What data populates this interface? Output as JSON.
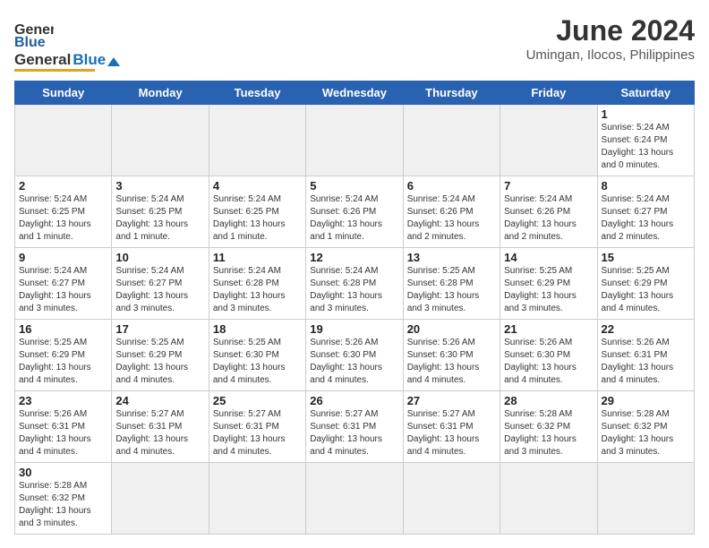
{
  "header": {
    "logo_general": "General",
    "logo_blue": "Blue",
    "title": "June 2024",
    "subtitle": "Umingan, Ilocos, Philippines"
  },
  "days_of_week": [
    "Sunday",
    "Monday",
    "Tuesday",
    "Wednesday",
    "Thursday",
    "Friday",
    "Saturday"
  ],
  "weeks": [
    [
      {
        "day": "",
        "info": ""
      },
      {
        "day": "",
        "info": ""
      },
      {
        "day": "",
        "info": ""
      },
      {
        "day": "",
        "info": ""
      },
      {
        "day": "",
        "info": ""
      },
      {
        "day": "",
        "info": ""
      },
      {
        "day": "1",
        "info": "Sunrise: 5:24 AM\nSunset: 6:24 PM\nDaylight: 13 hours and 0 minutes."
      }
    ],
    [
      {
        "day": "2",
        "info": "Sunrise: 5:24 AM\nSunset: 6:25 PM\nDaylight: 13 hours and 1 minute."
      },
      {
        "day": "3",
        "info": "Sunrise: 5:24 AM\nSunset: 6:25 PM\nDaylight: 13 hours and 1 minute."
      },
      {
        "day": "4",
        "info": "Sunrise: 5:24 AM\nSunset: 6:25 PM\nDaylight: 13 hours and 1 minute."
      },
      {
        "day": "5",
        "info": "Sunrise: 5:24 AM\nSunset: 6:26 PM\nDaylight: 13 hours and 1 minute."
      },
      {
        "day": "6",
        "info": "Sunrise: 5:24 AM\nSunset: 6:26 PM\nDaylight: 13 hours and 2 minutes."
      },
      {
        "day": "7",
        "info": "Sunrise: 5:24 AM\nSunset: 6:26 PM\nDaylight: 13 hours and 2 minutes."
      },
      {
        "day": "8",
        "info": "Sunrise: 5:24 AM\nSunset: 6:27 PM\nDaylight: 13 hours and 2 minutes."
      }
    ],
    [
      {
        "day": "9",
        "info": "Sunrise: 5:24 AM\nSunset: 6:27 PM\nDaylight: 13 hours and 3 minutes."
      },
      {
        "day": "10",
        "info": "Sunrise: 5:24 AM\nSunset: 6:27 PM\nDaylight: 13 hours and 3 minutes."
      },
      {
        "day": "11",
        "info": "Sunrise: 5:24 AM\nSunset: 6:28 PM\nDaylight: 13 hours and 3 minutes."
      },
      {
        "day": "12",
        "info": "Sunrise: 5:24 AM\nSunset: 6:28 PM\nDaylight: 13 hours and 3 minutes."
      },
      {
        "day": "13",
        "info": "Sunrise: 5:25 AM\nSunset: 6:28 PM\nDaylight: 13 hours and 3 minutes."
      },
      {
        "day": "14",
        "info": "Sunrise: 5:25 AM\nSunset: 6:29 PM\nDaylight: 13 hours and 3 minutes."
      },
      {
        "day": "15",
        "info": "Sunrise: 5:25 AM\nSunset: 6:29 PM\nDaylight: 13 hours and 4 minutes."
      }
    ],
    [
      {
        "day": "16",
        "info": "Sunrise: 5:25 AM\nSunset: 6:29 PM\nDaylight: 13 hours and 4 minutes."
      },
      {
        "day": "17",
        "info": "Sunrise: 5:25 AM\nSunset: 6:29 PM\nDaylight: 13 hours and 4 minutes."
      },
      {
        "day": "18",
        "info": "Sunrise: 5:25 AM\nSunset: 6:30 PM\nDaylight: 13 hours and 4 minutes."
      },
      {
        "day": "19",
        "info": "Sunrise: 5:26 AM\nSunset: 6:30 PM\nDaylight: 13 hours and 4 minutes."
      },
      {
        "day": "20",
        "info": "Sunrise: 5:26 AM\nSunset: 6:30 PM\nDaylight: 13 hours and 4 minutes."
      },
      {
        "day": "21",
        "info": "Sunrise: 5:26 AM\nSunset: 6:30 PM\nDaylight: 13 hours and 4 minutes."
      },
      {
        "day": "22",
        "info": "Sunrise: 5:26 AM\nSunset: 6:31 PM\nDaylight: 13 hours and 4 minutes."
      }
    ],
    [
      {
        "day": "23",
        "info": "Sunrise: 5:26 AM\nSunset: 6:31 PM\nDaylight: 13 hours and 4 minutes."
      },
      {
        "day": "24",
        "info": "Sunrise: 5:27 AM\nSunset: 6:31 PM\nDaylight: 13 hours and 4 minutes."
      },
      {
        "day": "25",
        "info": "Sunrise: 5:27 AM\nSunset: 6:31 PM\nDaylight: 13 hours and 4 minutes."
      },
      {
        "day": "26",
        "info": "Sunrise: 5:27 AM\nSunset: 6:31 PM\nDaylight: 13 hours and 4 minutes."
      },
      {
        "day": "27",
        "info": "Sunrise: 5:27 AM\nSunset: 6:31 PM\nDaylight: 13 hours and 4 minutes."
      },
      {
        "day": "28",
        "info": "Sunrise: 5:28 AM\nSunset: 6:32 PM\nDaylight: 13 hours and 3 minutes."
      },
      {
        "day": "29",
        "info": "Sunrise: 5:28 AM\nSunset: 6:32 PM\nDaylight: 13 hours and 3 minutes."
      }
    ],
    [
      {
        "day": "30",
        "info": "Sunrise: 5:28 AM\nSunset: 6:32 PM\nDaylight: 13 hours and 3 minutes."
      },
      {
        "day": "",
        "info": ""
      },
      {
        "day": "",
        "info": ""
      },
      {
        "day": "",
        "info": ""
      },
      {
        "day": "",
        "info": ""
      },
      {
        "day": "",
        "info": ""
      },
      {
        "day": "",
        "info": ""
      }
    ]
  ]
}
